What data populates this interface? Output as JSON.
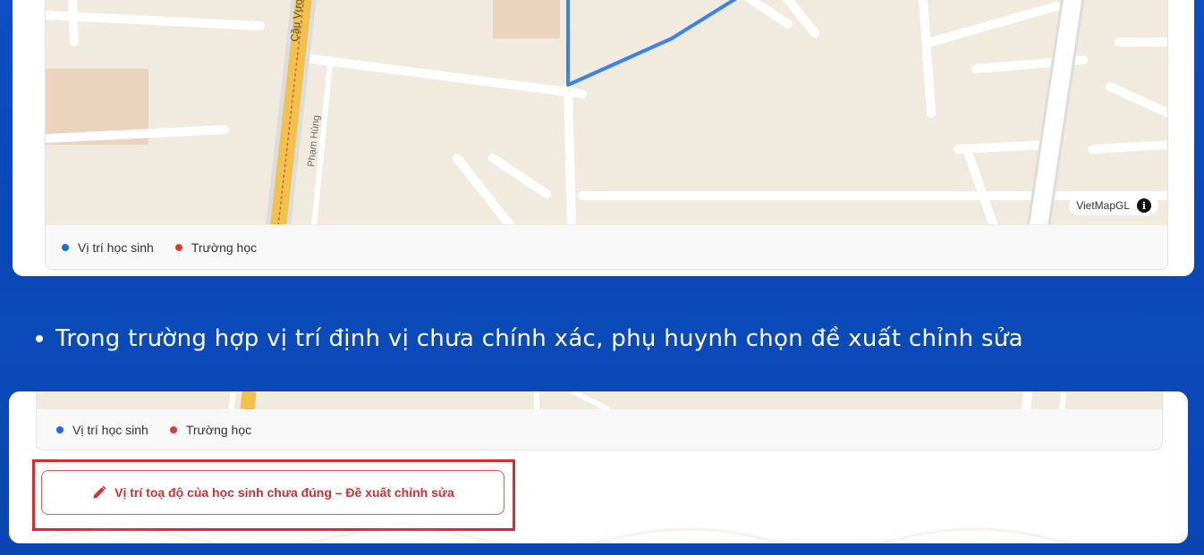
{
  "map": {
    "road_label_main": "Cầu Vượt Mai",
    "road_label_side": "Phạm Hùng",
    "attribution": "VietMapGL",
    "info_icon": "info-icon"
  },
  "legend": {
    "student_location": "Vị trí học sinh",
    "school": "Trường học",
    "colors": {
      "student": "#1e6ae0",
      "school": "#e53935"
    }
  },
  "instruction": {
    "text": "Trong trường hợp vị trí định vị chưa chính xác, phụ huynh chọn đề xuất chỉnh sửa"
  },
  "suggest_button": {
    "icon": "pencil-icon",
    "label": "Vị trí toạ độ của học sinh chưa đúng – Đề xuất chỉnh sửa"
  },
  "colors": {
    "background": "#0b4ab9",
    "highlight": "#e0282a",
    "route": "#3b82f0"
  }
}
